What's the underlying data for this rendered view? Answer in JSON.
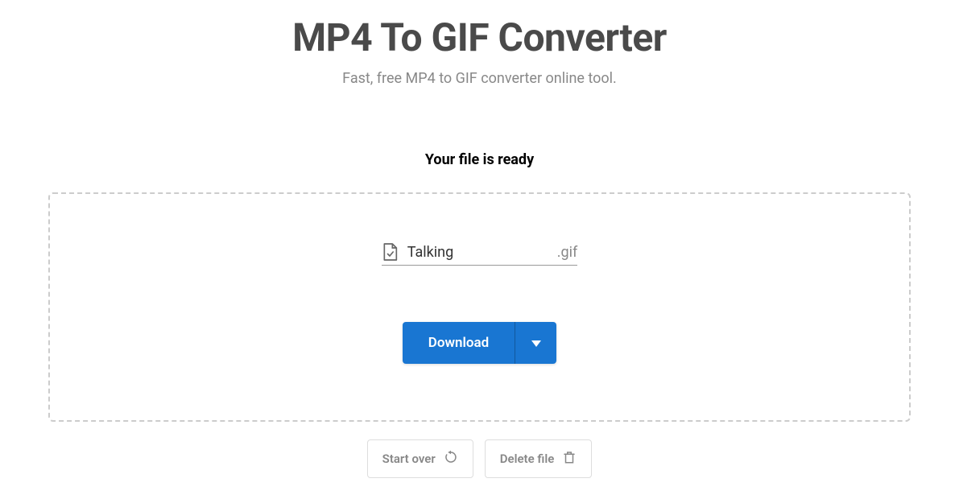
{
  "header": {
    "title": "MP4 To GIF Converter",
    "subtitle": "Fast, free MP4 to GIF converter online tool."
  },
  "status": {
    "message": "Your file is ready"
  },
  "file": {
    "name": "Talking",
    "extension": ".gif"
  },
  "download": {
    "label": "Download"
  },
  "actions": {
    "start_over": "Start over",
    "delete_file": "Delete file"
  }
}
